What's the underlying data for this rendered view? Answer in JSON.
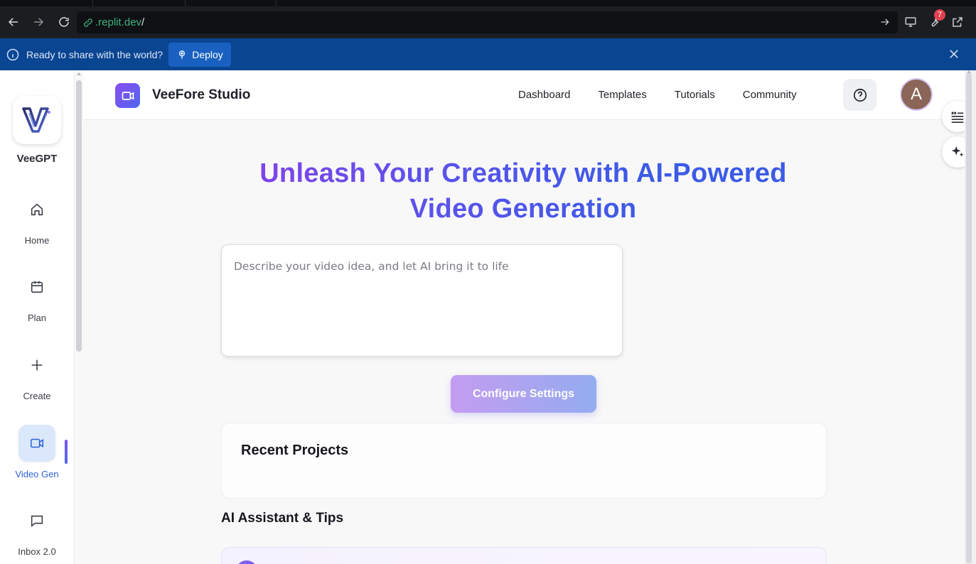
{
  "browser": {
    "url_host": ".replit.dev",
    "url_path": "/",
    "notification_count": "7"
  },
  "banner": {
    "message": "Ready to share with the world?",
    "deploy_label": "Deploy"
  },
  "sidebar": {
    "brand": "VeeGPT",
    "items": [
      {
        "label": "Home",
        "icon": "home-icon"
      },
      {
        "label": "Plan",
        "icon": "calendar-icon"
      },
      {
        "label": "Create",
        "icon": "plus-icon"
      },
      {
        "label": "Video Gen",
        "icon": "video-camera-icon",
        "active": true
      },
      {
        "label": "Inbox 2.0",
        "icon": "chat-bubble-icon"
      }
    ]
  },
  "header": {
    "title": "VeeFore Studio",
    "nav": [
      "Dashboard",
      "Templates",
      "Tutorials",
      "Community"
    ],
    "avatar_initial": "A"
  },
  "main": {
    "hero_line1": "Unleash Your Creativity with AI-Powered",
    "hero_line2": "Video Generation",
    "prompt_placeholder": "Describe your video idea, and let AI bring it to life",
    "configure_label": "Configure Settings",
    "recent_title": "Recent Projects",
    "tips_title": "AI Assistant & Tips"
  },
  "colors": {
    "accent": "#3b5ae6",
    "accent_purple": "#8b3fe8",
    "banner": "#0a4592",
    "url_green": "#3fb37f"
  }
}
